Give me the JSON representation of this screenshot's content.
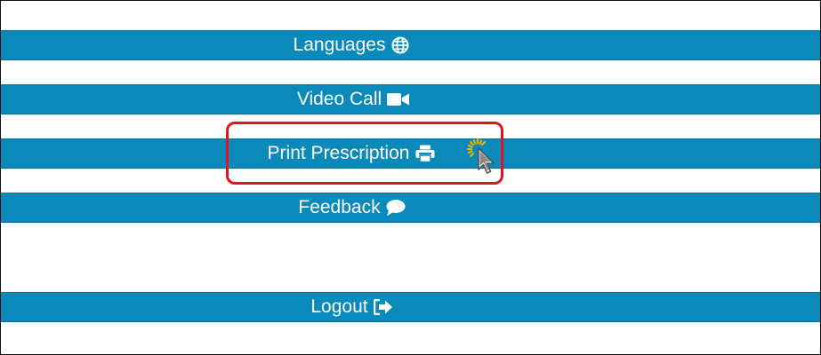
{
  "menu": {
    "languages": {
      "label": "Languages",
      "icon": "globe-icon"
    },
    "video_call": {
      "label": "Video Call",
      "icon": "video-camera-icon"
    },
    "print_prescription": {
      "label": "Print Prescription",
      "icon": "printer-icon"
    },
    "feedback": {
      "label": "Feedback",
      "icon": "speech-bubble-icon"
    },
    "logout": {
      "label": "Logout",
      "icon": "sign-out-icon"
    }
  },
  "colors": {
    "bar_background": "#0a8abb",
    "bar_text": "#ffffff",
    "highlight": "#e0141e",
    "click_burst": "#e8b400"
  },
  "annotation": {
    "highlighted_item": "print_prescription",
    "cursor": "arrow-pointer-icon"
  }
}
